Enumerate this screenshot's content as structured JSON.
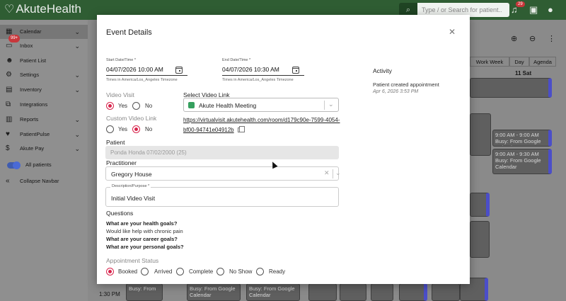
{
  "app": {
    "logo_text": "AkuteHealth",
    "search_placeholder": "Type / or Search for patient..",
    "notification_count": "29"
  },
  "sidebar": {
    "items": [
      {
        "label": "Calendar",
        "icon": "calendar-icon"
      },
      {
        "label": "Inbox",
        "icon": "inbox-icon",
        "badge": "99+"
      },
      {
        "label": "Patient List",
        "icon": "people-icon"
      },
      {
        "label": "Settings",
        "icon": "gear-icon"
      },
      {
        "label": "Inventory",
        "icon": "box-icon"
      },
      {
        "label": "Integrations",
        "icon": "plug-icon"
      },
      {
        "label": "Reports",
        "icon": "chart-icon"
      },
      {
        "label": "PatientPulse",
        "icon": "pulse-icon"
      },
      {
        "label": "Akute Pay",
        "icon": "dollar-icon"
      }
    ],
    "all_patients_label": "All patients",
    "collapse_label": "Collapse Navbar"
  },
  "calendar_bg": {
    "view_tabs": [
      "Work Week",
      "Day",
      "Agenda"
    ],
    "day_header": "11 Sat",
    "events": [
      {
        "text": "9:00 AM - 9:00 AM\nBusy: From Google Calendar"
      },
      {
        "text": "9:00 AM - 9:30 AM\nBusy: From Google Calendar"
      },
      {
        "text": "Busy: From Google Calendar"
      },
      {
        "text": "Busy: From Google Calendar"
      },
      {
        "text": "Busy: From"
      }
    ],
    "time_label": "1:30 PM"
  },
  "modal": {
    "title": "Event Details",
    "start": {
      "label": "Start Date/Time *",
      "value": "04/07/2026 10:00 AM",
      "hint": "Times in America/Los_Angeles Timezone"
    },
    "end": {
      "label": "End Date/Time *",
      "value": "04/07/2026 10:30 AM",
      "hint": "Times in America/Los_Angeles Timezone"
    },
    "video_visit": {
      "label": "Video Visit",
      "yes": "Yes",
      "no": "No",
      "selected": "Yes"
    },
    "select_video_link": {
      "label": "Select Video Link",
      "value": "Akute Health Meeting"
    },
    "custom_video_link": {
      "label": "Custom Video Link",
      "yes": "Yes",
      "no": "No",
      "selected": "No"
    },
    "video_url": "https://virtualvisit.akutehealth.com/room/d179c90e-7599-4054-bf00-94741e04912b",
    "patient": {
      "label": "Patient",
      "value": "Ponda Honda 07/02/2000 (25)"
    },
    "practitioner": {
      "label": "Practitioner",
      "value": "Gregory House"
    },
    "description": {
      "label": "Description/Purpose *",
      "value": "Initial Video Visit"
    },
    "questions": {
      "label": "Questions",
      "lines": [
        {
          "text": "What are your health goals?",
          "kind": "q"
        },
        {
          "text": "Would like help with chronic pain",
          "kind": "a"
        },
        {
          "text": "What are your career goals?",
          "kind": "q"
        },
        {
          "text": "What are your personal goals?",
          "kind": "q"
        }
      ]
    },
    "appointment_status": {
      "label": "Appointment Status",
      "options": [
        "Booked",
        "Arrived",
        "Complete",
        "No Show",
        "Ready"
      ],
      "selected": "Booked"
    },
    "activity": {
      "title": "Activity",
      "entry": "Patient created appointment",
      "time": "Apr 6, 2026 3:53 PM"
    }
  },
  "colors": {
    "brand_green": "#2f5d33",
    "accent_red": "#d8234b",
    "event_purple": "#4b4ec9"
  }
}
